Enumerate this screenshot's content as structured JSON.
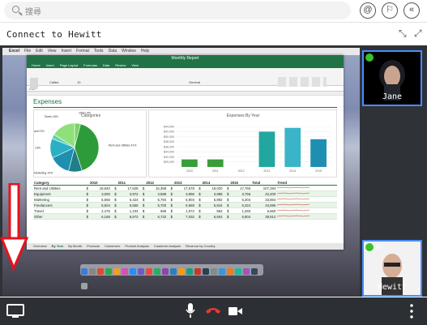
{
  "search": {
    "placeholder": "搜尋"
  },
  "toolbar": {
    "at_label": "@",
    "flag_label": "⚐",
    "collapse_label": "«"
  },
  "window": {
    "title": "Connect to Hewitt"
  },
  "shared_screen": {
    "app_menu": [
      "Excel",
      "File",
      "Edit",
      "View",
      "Insert",
      "Format",
      "Tools",
      "Data",
      "Window",
      "Help"
    ],
    "workbook_title": "Monthly Report",
    "ribbon_tabs": [
      "Home",
      "Insert",
      "Page Layout",
      "Formulas",
      "Data",
      "Review",
      "View"
    ],
    "font_name": "Calibri",
    "font_size": "10",
    "number_format": "General",
    "cell_ref": "C32",
    "sheet_heading": "Expenses",
    "pie_chart": {
      "title": "Categories",
      "slices": [
        {
          "label": "Other",
          "value": 4,
          "color": "#7fd16a"
        },
        {
          "label": "Rent and Utilities",
          "value": 41,
          "color": "#2e9b3a"
        },
        {
          "label": "Equipment",
          "value": 9,
          "color": "#1e7e8a"
        },
        {
          "label": "Marketing",
          "value": 14,
          "color": "#1f8fb0"
        },
        {
          "label": "Freelancers",
          "value": 13,
          "color": "#2ab0c4"
        },
        {
          "label": "Travel",
          "value": 3,
          "color": "#5fd0b8"
        },
        {
          "label": "Taxes",
          "value": 16,
          "color": "#8fe07a"
        }
      ]
    },
    "bar_chart": {
      "type": "bar",
      "title": "Expenses By Year",
      "categories": [
        "2010",
        "2011",
        "2012",
        "2013",
        "2014",
        "2015"
      ],
      "values": [
        31000,
        31000,
        27000,
        42000,
        43500,
        39000
      ],
      "yticks": [
        "$44,000",
        "$42,000",
        "$40,000",
        "$38,000",
        "$36,000",
        "$34,000",
        "$32,000",
        "$30,000"
      ],
      "ylim": [
        28000,
        46000
      ],
      "colors": [
        "#3a9d3a",
        "#3a9d3a",
        "#3a9d3a",
        "#22a7a0",
        "#3ab4c8",
        "#1e8fb0"
      ]
    },
    "table": {
      "headers": [
        "Category",
        "",
        "2010",
        "",
        "2011",
        "",
        "2012",
        "",
        "2013",
        "",
        "2014",
        "",
        "2015",
        "Total",
        "Trend"
      ],
      "rows": [
        [
          "Rent and Utilities",
          "$",
          "18,840",
          "$",
          "17,628",
          "$",
          "16,368",
          "$",
          "17,678",
          "$",
          "19,020",
          "$",
          "17,760",
          "107,294"
        ],
        [
          "Equipment",
          "$",
          "3,000",
          "$",
          "3,972",
          "$",
          "3,588",
          "$",
          "3,996",
          "$",
          "3,888",
          "$",
          "3,756",
          "22,200"
        ],
        [
          "Marketing",
          "$",
          "5,556",
          "$",
          "5,424",
          "$",
          "5,784",
          "$",
          "5,904",
          "$",
          "5,892",
          "$",
          "5,304",
          "33,864"
        ],
        [
          "Freelancers",
          "$",
          "5,604",
          "$",
          "5,556",
          "$",
          "5,700",
          "$",
          "5,568",
          "$",
          "5,844",
          "$",
          "6,324",
          "34,596"
        ],
        [
          "Travel",
          "$",
          "2,476",
          "$",
          "1,104",
          "$",
          "696",
          "$",
          "1,572",
          "$",
          "552",
          "$",
          "1,260",
          "6,660"
        ],
        [
          "Other",
          "$",
          "6,168",
          "$",
          "6,672",
          "$",
          "6,732",
          "$",
          "7,032",
          "$",
          "6,504",
          "$",
          "6,804",
          "39,912"
        ]
      ]
    },
    "sheet_tabs": [
      "Overview",
      "By Year",
      "By Month",
      "Products",
      "Customers",
      "Product Analysis",
      "Customer Analysis",
      "Revenue by Country"
    ],
    "active_sheet": "By Year"
  },
  "participants": [
    {
      "name": "Jane"
    },
    {
      "name": "Hewitt"
    }
  ],
  "colors": {
    "arrow": "#e8111b",
    "hangup": "#e53935",
    "tile_border": "#4a8cff",
    "badge": "#37c22a"
  }
}
